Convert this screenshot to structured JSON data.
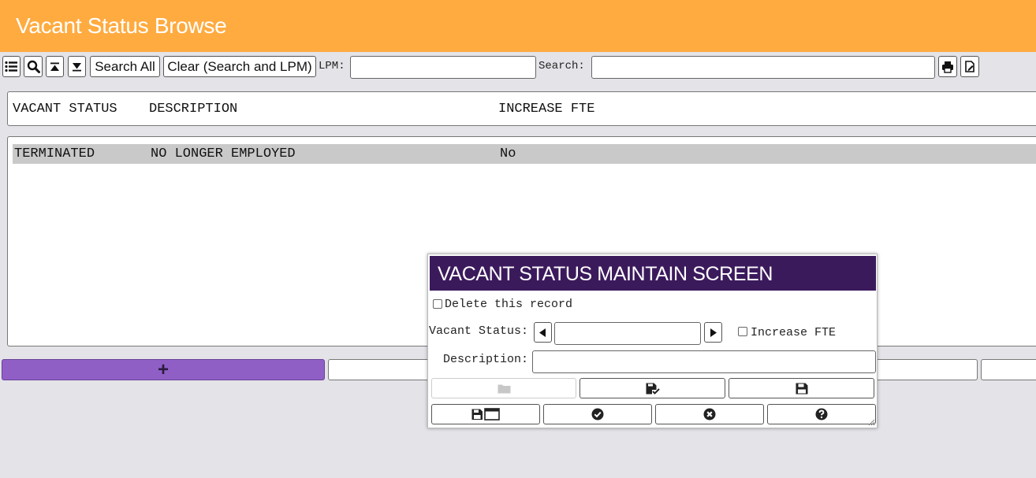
{
  "header": {
    "title": "Vacant Status Browse"
  },
  "toolbar": {
    "search_all_label": "Search All",
    "clear_label": "Clear (Search and LPM)",
    "lpm_label": "LPM:",
    "lpm_value": "",
    "search_label": "Search:",
    "search_value": ""
  },
  "grid": {
    "columns": [
      "VACANT STATUS",
      "DESCRIPTION",
      "INCREASE FTE"
    ],
    "rows": [
      {
        "vacant_status": "TERMINATED",
        "description": "NO LONGER EMPLOYED",
        "increase_fte": "No"
      }
    ]
  },
  "bottom_bar": {
    "add_label": "+"
  },
  "modal": {
    "title": "VACANT STATUS MAINTAIN SCREEN",
    "delete_label": "Delete this record",
    "delete_checked": false,
    "vacant_status_label": "Vacant Status:",
    "vacant_status_value": "",
    "increase_fte_label": "Increase FTE",
    "increase_fte_checked": false,
    "description_label": "Description:",
    "description_value": ""
  },
  "colors": {
    "header_bg": "#ffab40",
    "modal_header_bg": "#3b1a5c",
    "add_button_bg": "#8f5fc6",
    "selected_row_bg": "#c9c9c9",
    "page_bg": "#e4e3e8"
  },
  "icons": {
    "toolbar": [
      "list-icon",
      "search-icon",
      "first-record-icon",
      "last-record-icon",
      "print-icon",
      "export-icon"
    ],
    "modal_row1": [
      "folder-icon",
      "save-check-icon",
      "save-icon"
    ],
    "modal_row2": [
      "save-window-icon",
      "check-circle-icon",
      "cancel-circle-icon",
      "help-circle-icon"
    ]
  }
}
